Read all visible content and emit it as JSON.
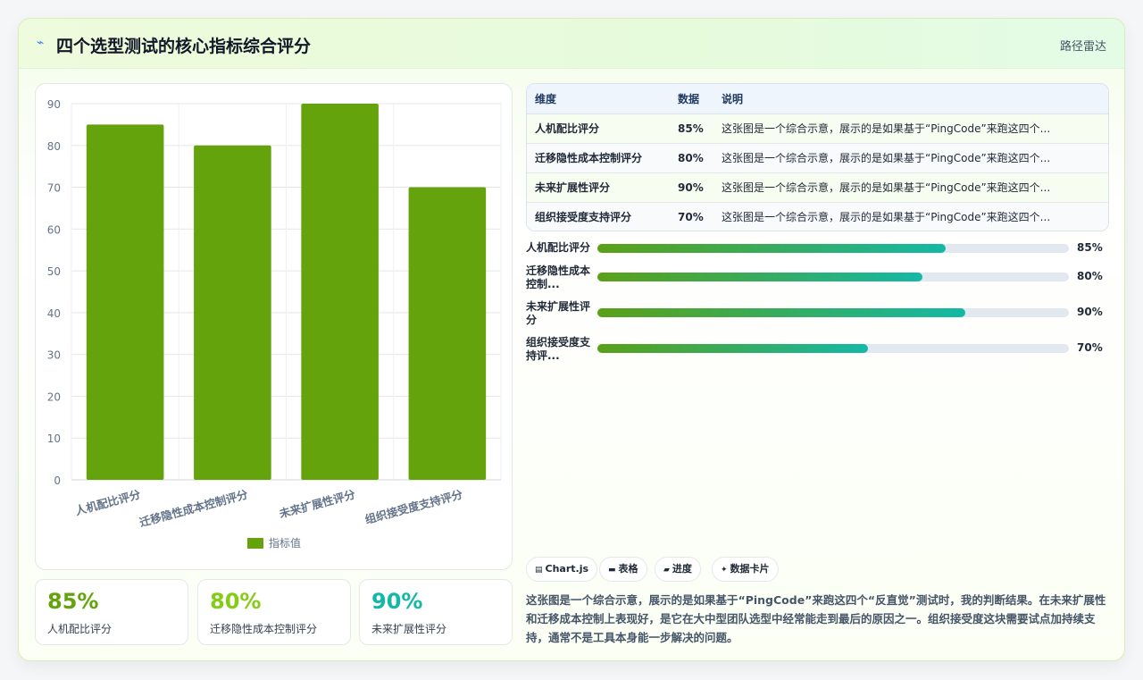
{
  "header": {
    "icon": "lightning-icon",
    "title": "四个选型测试的核心指标综合评分",
    "tag": "路径雷达"
  },
  "chart_data": {
    "type": "bar",
    "categories": [
      "人机配比评分",
      "迁移隐性成本控制评分",
      "未来扩展性评分",
      "组织接受度支持评分"
    ],
    "series": [
      {
        "name": "指标值",
        "values": [
          85,
          80,
          90,
          70
        ]
      }
    ],
    "ylim": [
      0,
      90
    ],
    "yticks": [
      0,
      10,
      20,
      30,
      40,
      50,
      60,
      70,
      80,
      90
    ],
    "grid": true,
    "legend": "bottom",
    "bar_color": "#65a30d"
  },
  "kpis": [
    {
      "value": "85%",
      "label": "人机配比评分",
      "color": "#65a30d"
    },
    {
      "value": "80%",
      "label": "迁移隐性成本控制评分",
      "color": "#84cc16"
    },
    {
      "value": "90%",
      "label": "未来扩展性评分",
      "color": "#14b8a6"
    }
  ],
  "table": {
    "headers": [
      "维度",
      "数据",
      "说明"
    ],
    "rows": [
      [
        "人机配比评分",
        "85%",
        "这张图是一个综合示意，展示的是如果基于“PingCode”来跑这四个..."
      ],
      [
        "迁移隐性成本控制评分",
        "80%",
        "这张图是一个综合示意，展示的是如果基于“PingCode”来跑这四个..."
      ],
      [
        "未来扩展性评分",
        "90%",
        "这张图是一个综合示意，展示的是如果基于“PingCode”来跑这四个..."
      ],
      [
        "组织接受度支持评分",
        "70%",
        "这张图是一个综合示意，展示的是如果基于“PingCode”来跑这四个..."
      ]
    ]
  },
  "progress": [
    {
      "label": "人机配比评分",
      "value": 85,
      "text": "85%"
    },
    {
      "label": "迁移隐性成本控制...",
      "value": 80,
      "text": "80%"
    },
    {
      "label": "未来扩展性评分",
      "value": 90,
      "text": "90%"
    },
    {
      "label": "组织接受度支持评...",
      "value": 70,
      "text": "70%"
    }
  ],
  "chips": [
    {
      "icon": "chart-icon",
      "glyph": "▤",
      "label": "Chart.js"
    },
    {
      "icon": "table-icon",
      "glyph": "▬",
      "label": "表格"
    },
    {
      "icon": "progress-icon",
      "glyph": "▰",
      "label": "进度"
    },
    {
      "icon": "card-icon",
      "glyph": "✦",
      "label": "数据卡片"
    }
  ],
  "description": "这张图是一个综合示意，展示的是如果基于“PingCode”来跑这四个“反直觉”测试时，我的判断结果。在未来扩展性和迁移成本控制上表现好，是它在大中型团队选型中经常能走到最后的原因之一。组织接受度这块需要试点加持续支持，通常不是工具本身能一步解决的问题。"
}
